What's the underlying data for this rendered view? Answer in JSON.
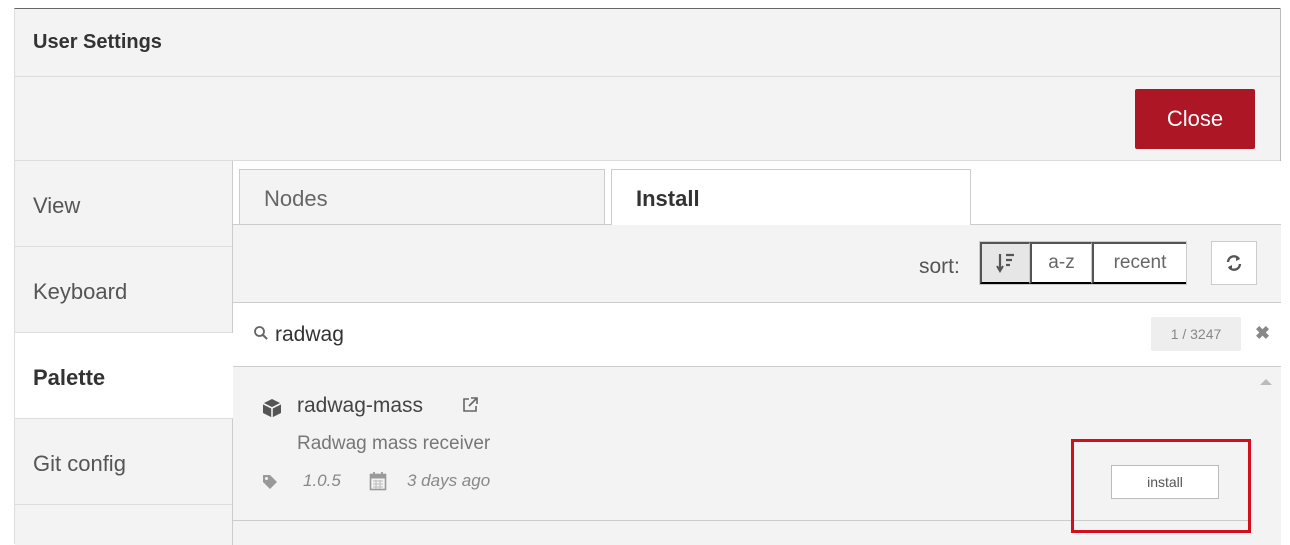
{
  "dialog": {
    "title": "User Settings",
    "close_label": "Close"
  },
  "sidebar": {
    "items": [
      {
        "label": "View",
        "active": false
      },
      {
        "label": "Keyboard",
        "active": false
      },
      {
        "label": "Palette",
        "active": true
      },
      {
        "label": "Git config",
        "active": false
      }
    ]
  },
  "tabs": [
    {
      "label": "Nodes",
      "active": false
    },
    {
      "label": "Install",
      "active": true
    }
  ],
  "sort": {
    "label": "sort:",
    "options": [
      "sort-by-relevance-icon",
      "a-z",
      "recent"
    ],
    "active": "sort-by-relevance-icon"
  },
  "search": {
    "value": "radwag",
    "count": "1 / 3247"
  },
  "results": [
    {
      "name": "radwag-mass",
      "description": "Radwag mass receiver",
      "version": "1.0.5",
      "updated": "3 days ago",
      "install_label": "install"
    }
  ],
  "colors": {
    "close_button": "#ad1625",
    "highlight": "#d0101d"
  }
}
